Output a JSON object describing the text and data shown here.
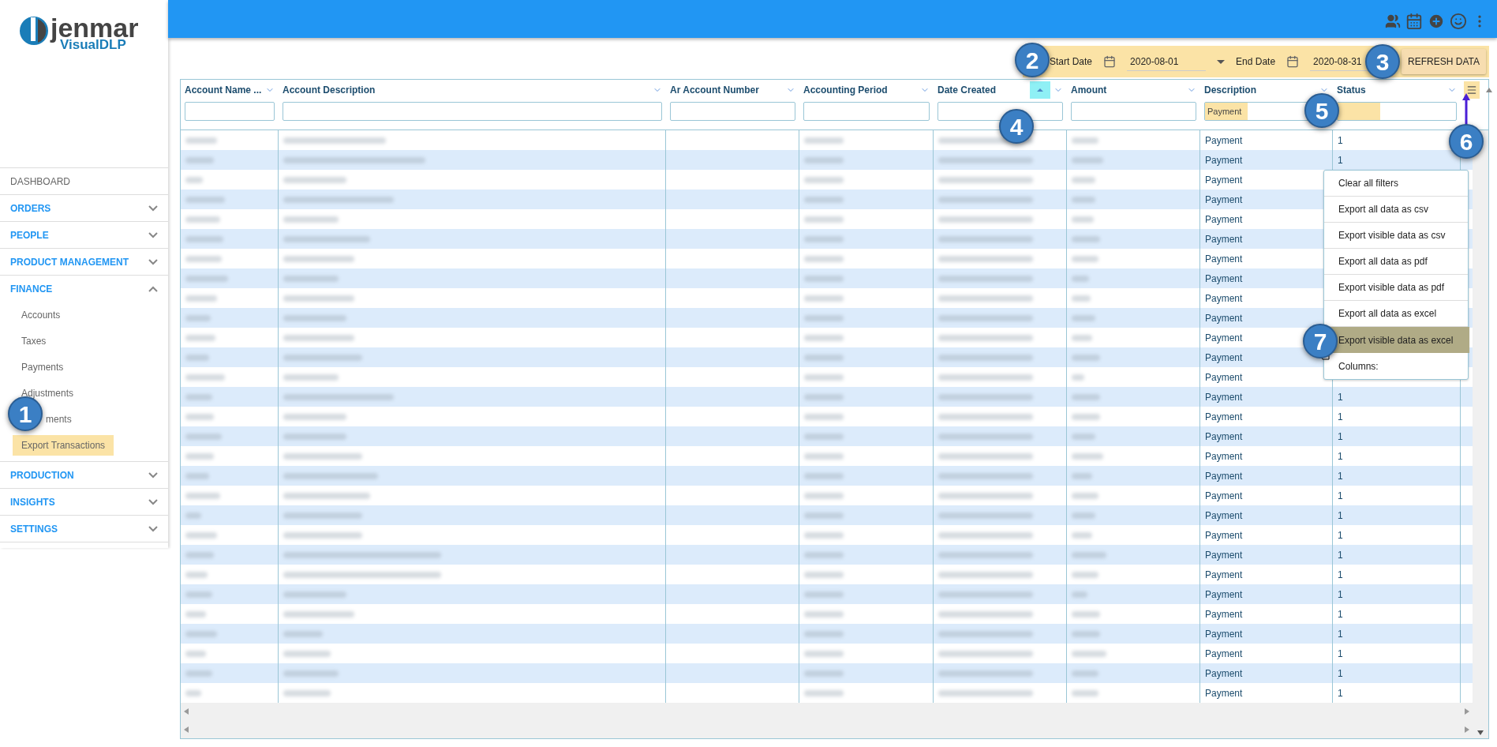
{
  "logo": {
    "brand": "jenmar",
    "product": "VisualDLP"
  },
  "sidebar": {
    "items": [
      {
        "label": "DASHBOARD",
        "kind": "plain"
      },
      {
        "label": "ORDERS",
        "kind": "section",
        "expanded": false
      },
      {
        "label": "PEOPLE",
        "kind": "section",
        "expanded": false
      },
      {
        "label": "PRODUCT MANAGEMENT",
        "kind": "section",
        "expanded": false
      },
      {
        "label": "FINANCE",
        "kind": "section",
        "expanded": true,
        "children": [
          {
            "label": "Accounts",
            "kind": "link",
            "highlighted": false
          },
          {
            "label": "Taxes",
            "kind": "link",
            "highlighted": false
          },
          {
            "label": "Payments",
            "kind": "link",
            "highlighted": false
          },
          {
            "label": "Adjustments",
            "kind": "link",
            "highlighted": false
          },
          {
            "label": "ments",
            "kind": "covered",
            "highlighted": false
          },
          {
            "label": "Export Transactions",
            "kind": "link",
            "highlighted": true
          }
        ]
      },
      {
        "label": "PRODUCTION",
        "kind": "section",
        "expanded": false
      },
      {
        "label": "INSIGHTS",
        "kind": "section",
        "expanded": false
      },
      {
        "label": "SETTINGS",
        "kind": "section",
        "expanded": false
      }
    ]
  },
  "date_bar": {
    "highlighted": true,
    "start_label": "Start Date",
    "start_value": "2020-08-01",
    "end_label": "End Date",
    "end_value": "2020-08-31",
    "refresh_button": "REFRESH DATA"
  },
  "table": {
    "columns": [
      {
        "label": "Account Name ...",
        "sorted_ascending": false,
        "highlighted": false
      },
      {
        "label": "Account Description",
        "sorted_ascending": false,
        "highlighted": false
      },
      {
        "label": "Ar Account Number",
        "sorted_ascending": false,
        "highlighted": false
      },
      {
        "label": "Accounting Period",
        "sorted_ascending": false,
        "highlighted": false
      },
      {
        "label": "Date Created",
        "sorted_ascending": true,
        "highlighted": false
      },
      {
        "label": "Amount",
        "sorted_ascending": false,
        "highlighted": false
      },
      {
        "label": "Description",
        "sorted_ascending": false,
        "filter": "Payment",
        "highlighted": true
      },
      {
        "label": "Status",
        "sorted_ascending": false,
        "highlighted": true
      }
    ],
    "menu_button_highlighted": true,
    "rows": [
      {
        "description": "Payment",
        "status": "1"
      },
      {
        "description": "Payment",
        "status": "1"
      },
      {
        "description": "Payment"
      },
      {
        "description": "Payment"
      },
      {
        "description": "Payment"
      },
      {
        "description": "Payment"
      },
      {
        "description": "Payment"
      },
      {
        "description": "Payment"
      },
      {
        "description": "Payment"
      },
      {
        "description": "Payment"
      },
      {
        "description": "Payment"
      },
      {
        "description": "Payment"
      },
      {
        "description": "Payment"
      },
      {
        "description": "Payment",
        "status": "1"
      },
      {
        "description": "Payment",
        "status": "1"
      },
      {
        "description": "Payment",
        "status": "1"
      },
      {
        "description": "Payment",
        "status": "1"
      },
      {
        "description": "Payment",
        "status": "1"
      },
      {
        "description": "Payment",
        "status": "1"
      },
      {
        "description": "Payment",
        "status": "1"
      },
      {
        "description": "Payment",
        "status": "1"
      },
      {
        "description": "Payment",
        "status": "1"
      },
      {
        "description": "Payment",
        "status": "1"
      },
      {
        "description": "Payment",
        "status": "1"
      },
      {
        "description": "Payment",
        "status": "1"
      },
      {
        "description": "Payment",
        "status": "1"
      },
      {
        "description": "Payment",
        "status": "1"
      },
      {
        "description": "Payment",
        "status": "1"
      },
      {
        "description": "Payment",
        "status": "1"
      }
    ]
  },
  "grid_menu": {
    "items": [
      {
        "label": "Clear all filters",
        "highlighted": false
      },
      {
        "label": "Export all data as csv",
        "highlighted": false
      },
      {
        "label": "Export visible data as csv",
        "highlighted": false
      },
      {
        "label": "Export all data as pdf",
        "highlighted": false
      },
      {
        "label": "Export visible data as pdf",
        "highlighted": false
      },
      {
        "label": "Export all data as excel",
        "highlighted": false
      },
      {
        "label": "Export visible data as excel",
        "highlighted": true
      },
      {
        "label": "Columns:",
        "highlighted": false
      }
    ]
  },
  "callouts": [
    "1",
    "2",
    "3",
    "4",
    "5",
    "6",
    "7"
  ]
}
